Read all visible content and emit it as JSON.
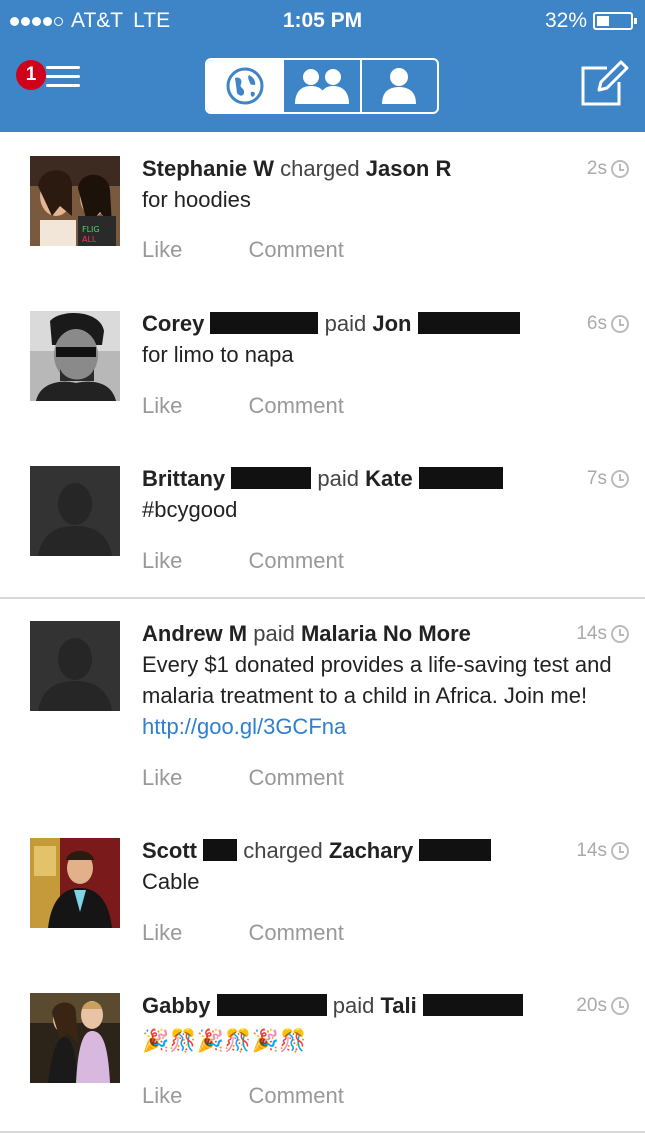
{
  "status_bar": {
    "carrier": "AT&T",
    "network": "LTE",
    "time": "1:05 PM",
    "battery": "32%"
  },
  "header": {
    "notification_count": "1",
    "tabs": [
      {
        "name": "public",
        "icon": "globe-icon",
        "active": true
      },
      {
        "name": "friends",
        "icon": "two-people-icon",
        "active": false
      },
      {
        "name": "mine",
        "icon": "person-icon",
        "active": false
      }
    ],
    "compose_icon": "compose-icon"
  },
  "actions": {
    "like_label": "Like",
    "comment_label": "Comment"
  },
  "feed": [
    {
      "actor": "Stephanie W",
      "verb": "charged",
      "target": "Jason R",
      "note": "for hoodies",
      "time": "2s"
    },
    {
      "actor": "Corey",
      "verb": "paid",
      "target": "Jon",
      "note": "for limo to napa",
      "time": "6s"
    },
    {
      "actor": "Brittany",
      "verb": "paid",
      "target": "Kate",
      "note": "#bcygood",
      "time": "7s"
    },
    {
      "actor": "Andrew M",
      "verb": "paid",
      "target": "Malaria No More",
      "note": "Every $1 donated provides a life-saving test and malaria treatment to a child in Africa. Join me!",
      "link": "http://goo.gl/3GCFna",
      "time": "14s"
    },
    {
      "actor": "Scott",
      "verb": "charged",
      "target": "Zachary",
      "note": "Cable",
      "time": "14s"
    },
    {
      "actor": "Gabby",
      "verb": "paid",
      "target": "Tali",
      "note": "🎉🎊🎉🎊🎉🎊",
      "time": "20s"
    }
  ]
}
